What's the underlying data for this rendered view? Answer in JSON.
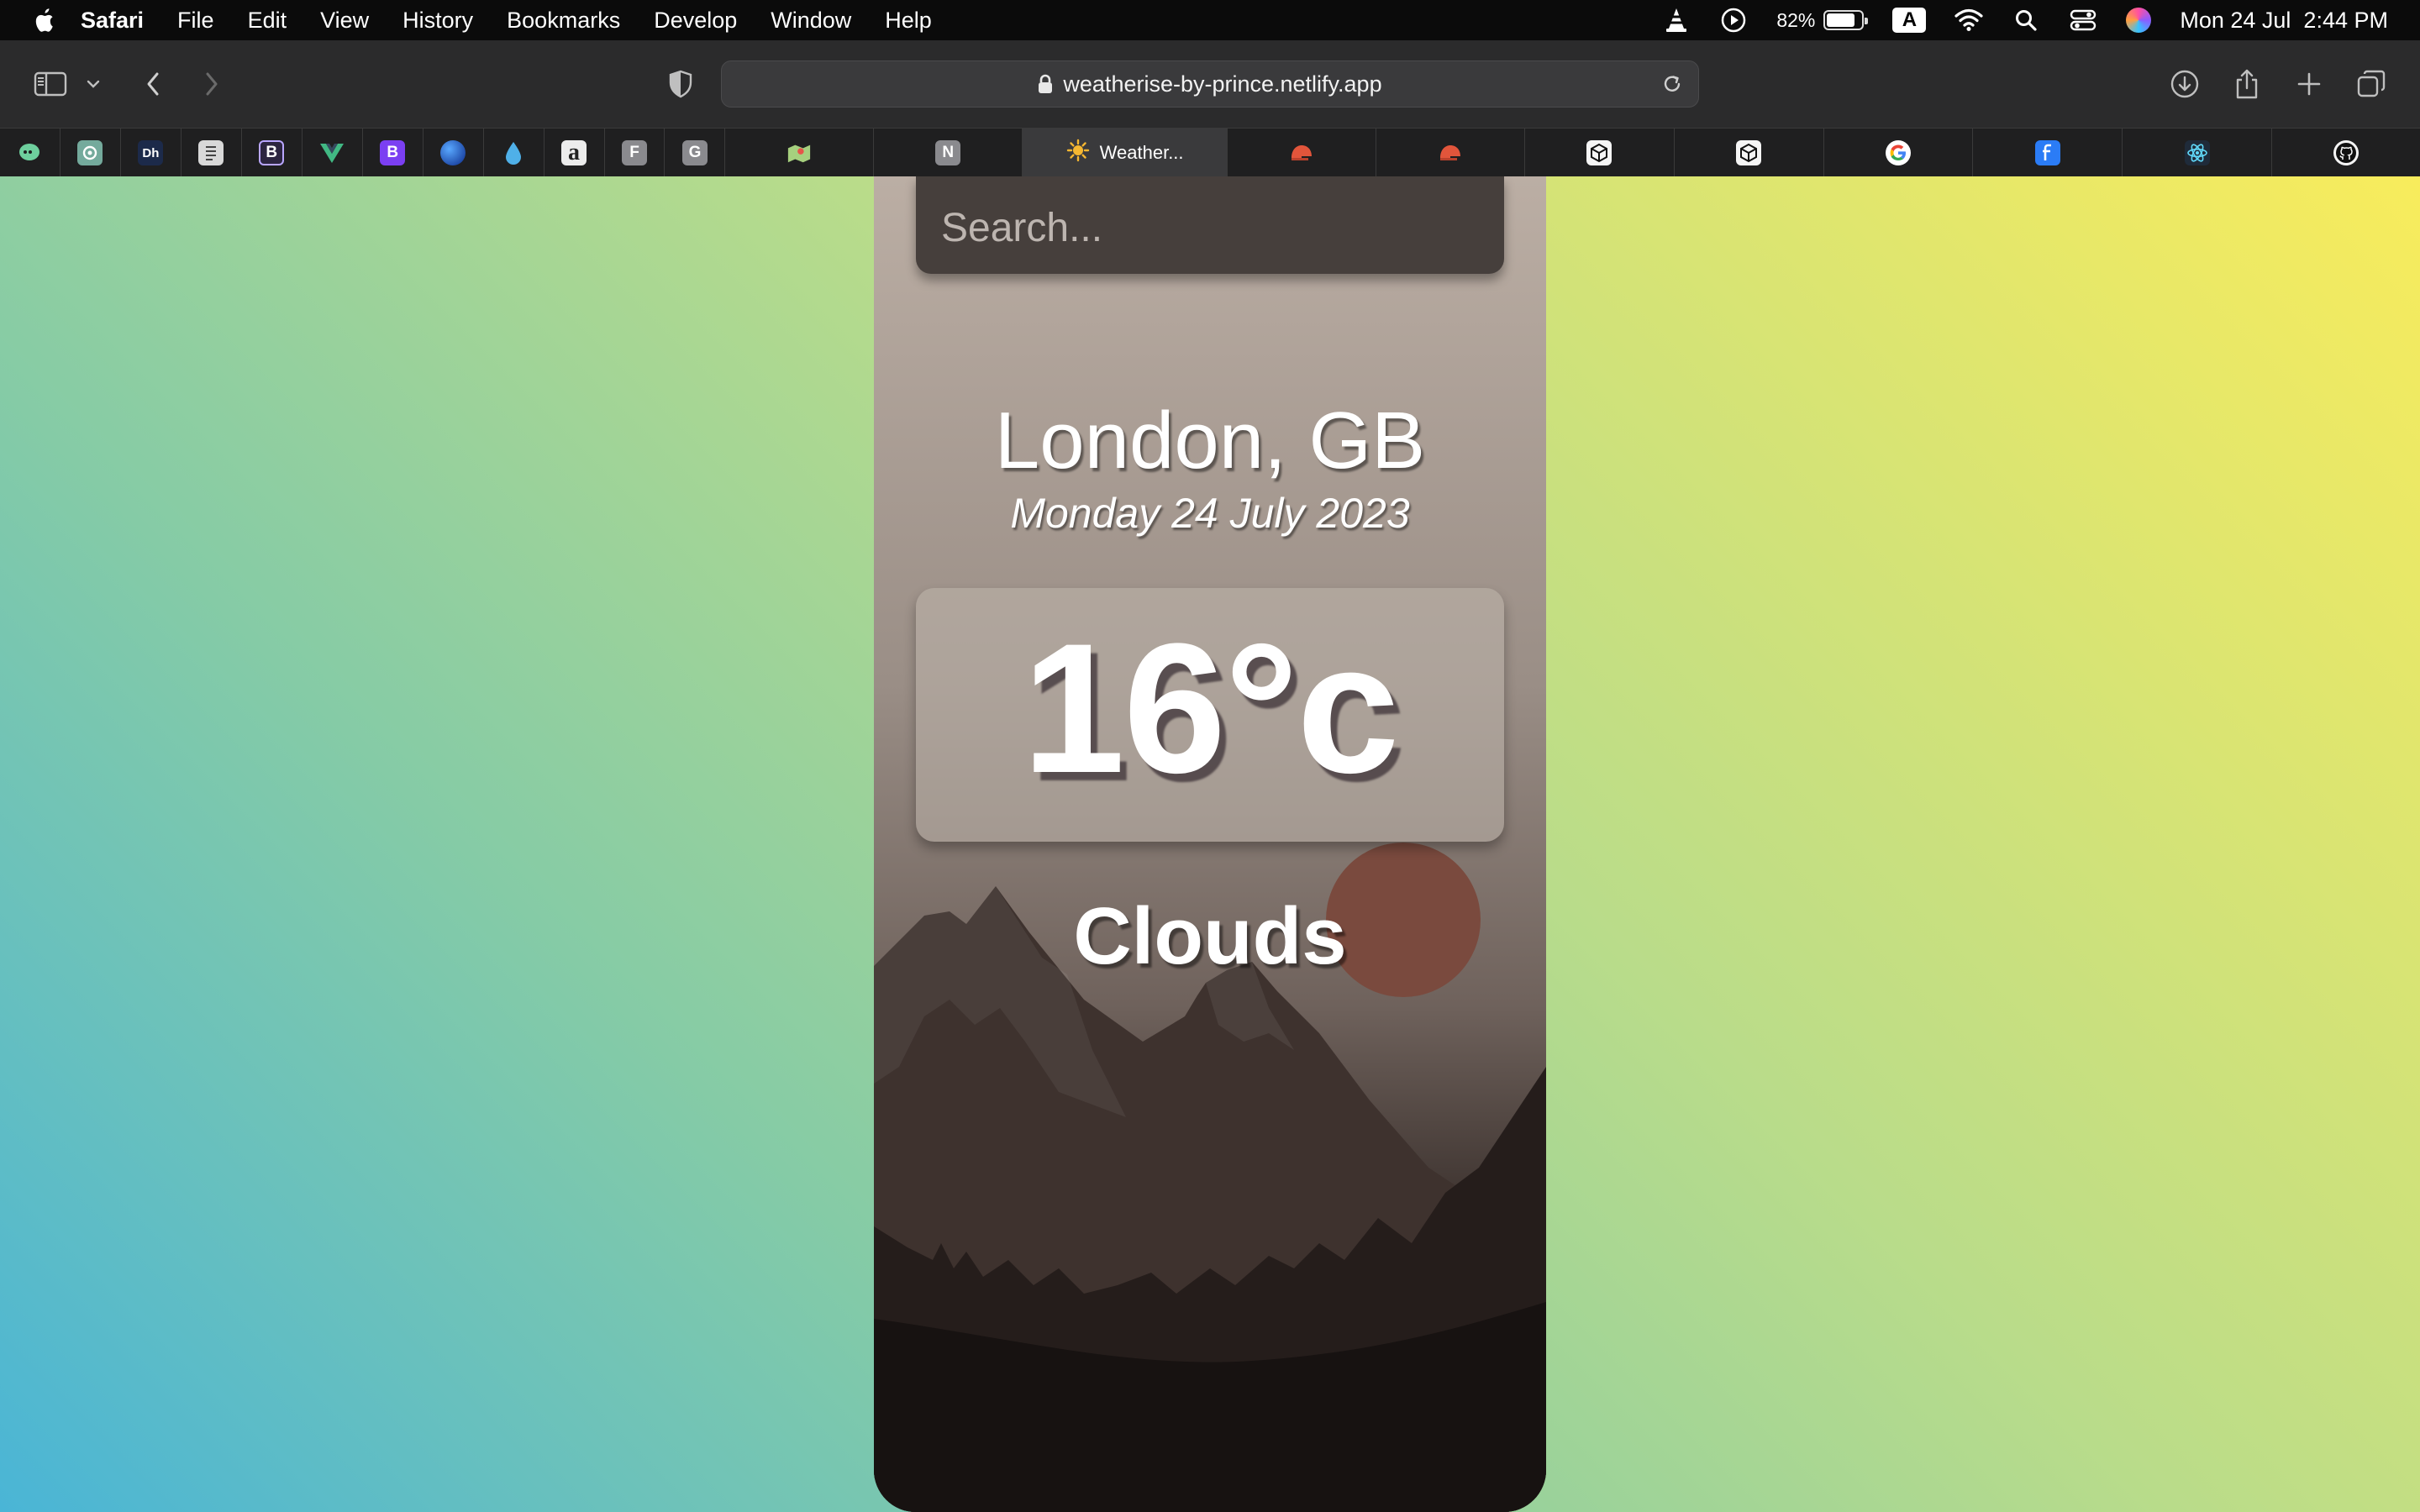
{
  "menubar": {
    "app_name": "Safari",
    "items": [
      "File",
      "Edit",
      "View",
      "History",
      "Bookmarks",
      "Develop",
      "Window",
      "Help"
    ],
    "battery_percent": "82%",
    "battery_level": 0.82,
    "input_source": "A",
    "datetime": "Mon 24 Jul  2:44 PM"
  },
  "toolbar": {
    "url": "weatherise-by-prince.netlify.app"
  },
  "tabs": {
    "active_title": "Weather...",
    "pinned_letters": {
      "b1": "B",
      "b2": "B",
      "a": "a",
      "f": "F",
      "g": "G",
      "n": "N",
      "dh": "Dh"
    }
  },
  "weather_app": {
    "search_placeholder": "Search...",
    "location": "London, GB",
    "date": "Monday 24 July 2023",
    "temperature": "16°c",
    "condition": "Clouds"
  },
  "colors": {
    "sun": "#7a4a3e",
    "mountain_far": "#3e322e",
    "mountain_near": "#251d1b"
  }
}
